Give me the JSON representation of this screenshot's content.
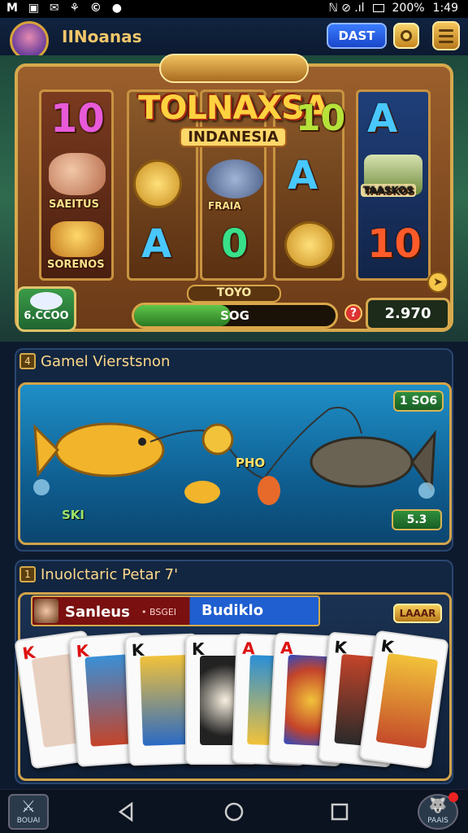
{
  "status_bar": {
    "left_icons": "M ▣ ✉ ⚘ ©  ●",
    "signal_text": "ℕ ⊘ .ıl",
    "battery": "200%",
    "time": "1:49"
  },
  "header": {
    "app_name": "IINoanas",
    "dast_label": "DAST"
  },
  "slot": {
    "logo_title": "TOLNAXSA",
    "logo_subtitle": "INDANESIA",
    "reel1": [
      "10",
      "SAEITUS",
      "SORENOS"
    ],
    "reel2": [
      "A",
      "FRAIA"
    ],
    "reel3": [
      "0",
      "A"
    ],
    "reel4": [
      "10",
      "A",
      "TAASKOS",
      "10"
    ],
    "left_box": "6.CCOO",
    "bar_label": "TOYO",
    "bar_value": "SOG",
    "bar_fill_fraction": 0.48,
    "help_label": "?",
    "balance": "2.970"
  },
  "panel1": {
    "number": "4",
    "title": "Gamel Vierstsnon",
    "tag_top": "1 SO6",
    "fish_label": "PHO",
    "left_label": "SKI",
    "tag_bottom": "5.3"
  },
  "panel2": {
    "number": "1",
    "title": "Inuolctaric Petar 7'",
    "player_name": "Sanleus",
    "player_small": "• BSGEI",
    "player_right": "Budiklo",
    "badge": "LAAAR",
    "cards": [
      "K",
      "K",
      "K",
      "K",
      "A",
      "A",
      "K",
      "K"
    ]
  },
  "navbar": {
    "left_label": "BOUAI",
    "right_label": "PAAIS"
  },
  "colors": {
    "accent_gold": "#d7a94d",
    "blue_button": "#2a5fe8",
    "green_bar": "#3f9e3a"
  }
}
